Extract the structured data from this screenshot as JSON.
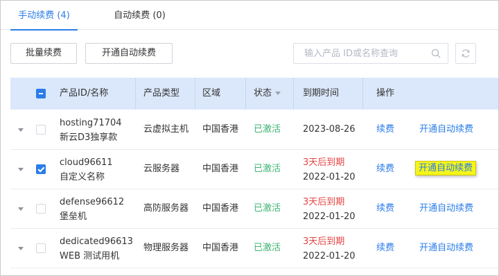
{
  "tabs": [
    {
      "label": "手动续费 (4)",
      "active": true
    },
    {
      "label": "自动续费 (0)",
      "active": false
    }
  ],
  "toolbar": {
    "batch_renew_label": "批量续费",
    "enable_auto_renew_label": "开通自动续费",
    "search_placeholder": "输入产品 ID或名称查询"
  },
  "table": {
    "headers": {
      "product": "产品ID/名称",
      "type": "产品类型",
      "region": "区域",
      "status": "状态",
      "expiry": "到期时间",
      "actions": "操作"
    },
    "rows": [
      {
        "id": "hosting71704",
        "name": "新云D3独享款",
        "type": "云虚拟主机",
        "region": "中国香港",
        "status": "已激活",
        "warning": "",
        "date": "2023-08-26",
        "renew": "续费",
        "auto": "开通自动续费",
        "checked": false
      },
      {
        "id": "cloud96611",
        "name": "自定义名称",
        "type": "云服务器",
        "region": "中国香港",
        "status": "已激活",
        "warning": "3天后到期",
        "date": "2022-01-20",
        "renew": "续费",
        "auto": "开通自动续费",
        "checked": true
      },
      {
        "id": "defense96612",
        "name": "堡垒机",
        "type": "高防服务器",
        "region": "中国香港",
        "status": "已激活",
        "warning": "3天后到期",
        "date": "2022-01-20",
        "renew": "续费",
        "auto": "开通自动续费",
        "checked": false
      },
      {
        "id": "dedicated96613",
        "name": "WEB 测试用机",
        "type": "物理服务器",
        "region": "中国香港",
        "status": "已激活",
        "warning": "3天后到期",
        "date": "2022-01-20",
        "renew": "续费",
        "auto": "开通自动续费",
        "checked": false
      }
    ]
  },
  "colors": {
    "accent": "#2b7de9",
    "header_bg": "#dbe8fb",
    "status_active": "#3cb371",
    "warning": "#e64545",
    "highlight": "#f5f51a"
  }
}
